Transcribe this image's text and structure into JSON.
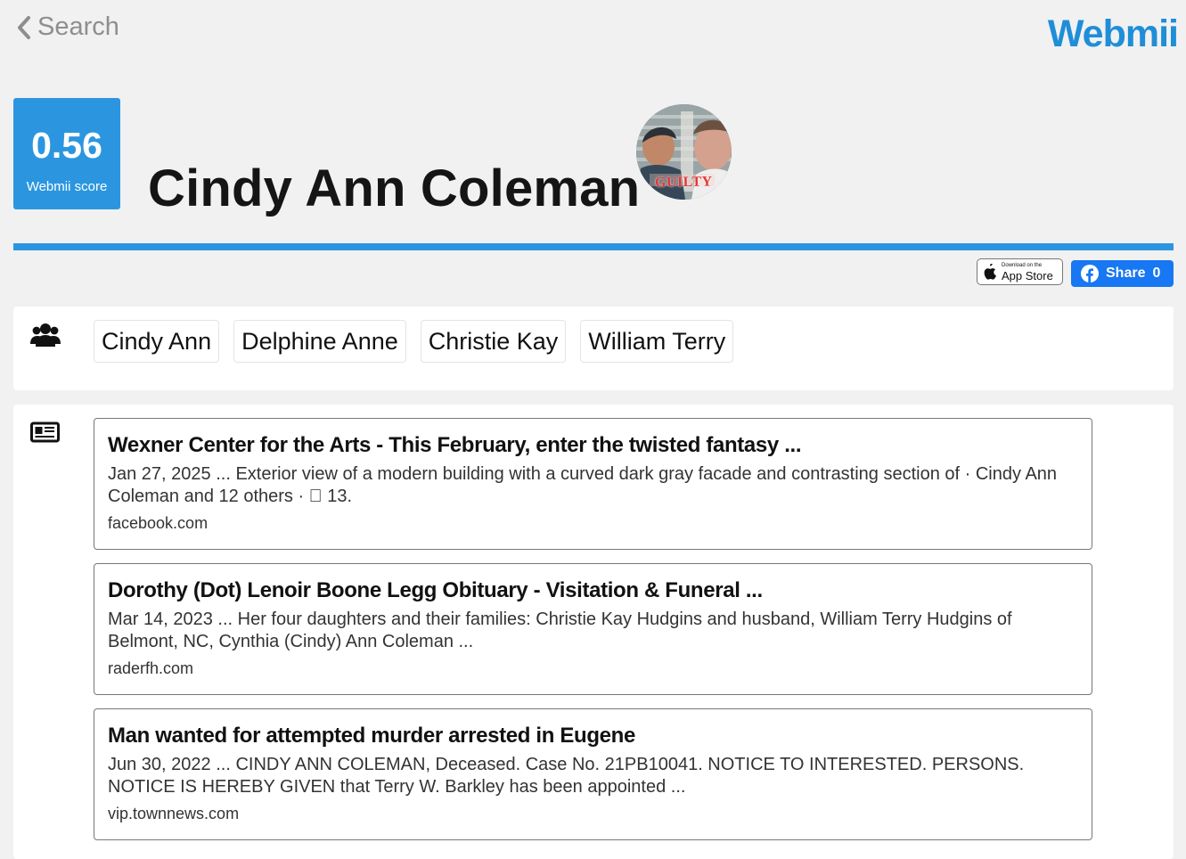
{
  "header": {
    "back_label": "Search",
    "logo_text": "Webmii",
    "back_icon": "chevron-left-icon"
  },
  "profile": {
    "score_value": "0.56",
    "score_label": "Webmii score",
    "name": "Cindy Ann Coleman",
    "avatar_overlay_text": "GUILTY"
  },
  "actions": {
    "app_store_small": "Download on the",
    "app_store_big": "App Store",
    "share_label": "Share",
    "share_count": "0"
  },
  "related_names": {
    "icon": "people-icon",
    "items": [
      "Cindy Ann",
      "Delphine Anne",
      "Christie Kay",
      "William Terry"
    ]
  },
  "results": {
    "icon": "newspaper-icon",
    "items": [
      {
        "title": "Wexner Center for the Arts - This February, enter the twisted fantasy ...",
        "snippet": "Jan 27, 2025 ... Exterior view of a modern building with a curved dark gray facade and contrasting section of · Cindy Ann Coleman and 12 others · 󰍸 13.",
        "domain": "facebook.com"
      },
      {
        "title": "Dorothy (Dot) Lenoir Boone Legg Obituary - Visitation & Funeral ...",
        "snippet": "Mar 14, 2023 ... Her four daughters and their families: Christie Kay Hudgins and husband, William Terry Hudgins of Belmont, NC, Cynthia (Cindy) Ann Coleman ...",
        "domain": "raderfh.com"
      },
      {
        "title": "Man wanted for attempted murder arrested in Eugene",
        "snippet": "Jun 30, 2022 ... CINDY ANN COLEMAN, Deceased. Case No. 21PB10041. NOTICE TO INTERESTED. PERSONS. NOTICE IS HEREBY GIVEN that Terry W. Barkley has been appointed ...",
        "domain": "vip.townnews.com"
      }
    ]
  },
  "colors": {
    "brand_blue": "#2b96df",
    "facebook_blue": "#1877f2",
    "page_background": "#f1f1f1"
  }
}
